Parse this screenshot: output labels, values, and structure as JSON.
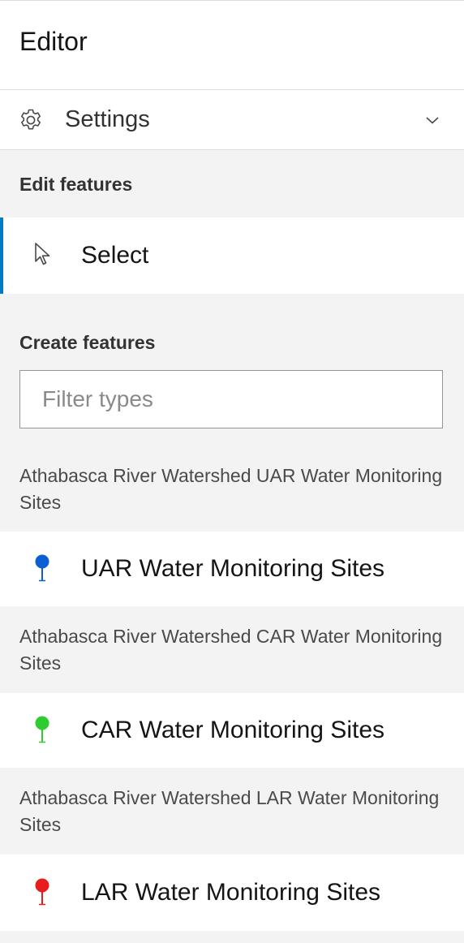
{
  "header": {
    "title": "Editor"
  },
  "settings": {
    "label": "Settings",
    "icon": "gear-icon",
    "expand_icon": "chevron-down-icon"
  },
  "edit_features": {
    "heading": "Edit features",
    "select_label": "Select",
    "select_icon": "cursor-arrow-icon",
    "accent_color": "#007ac2"
  },
  "create_features": {
    "heading": "Create features",
    "filter_placeholder": "Filter types",
    "filter_value": "",
    "groups": [
      {
        "title": "Athabasca River Watershed UAR Water Monitoring Sites",
        "template_label": "UAR Water Monitoring Sites",
        "pin_color": "#0a5fd1",
        "icon": "blue-pin-icon"
      },
      {
        "title": "Athabasca River Watershed CAR Water Monitoring Sites",
        "template_label": "CAR Water Monitoring Sites",
        "pin_color": "#2ecc2e",
        "icon": "green-pin-icon"
      },
      {
        "title": "Athabasca River Watershed LAR Water Monitoring Sites",
        "template_label": "LAR Water Monitoring Sites",
        "pin_color": "#e81c1c",
        "icon": "red-pin-icon"
      }
    ]
  }
}
